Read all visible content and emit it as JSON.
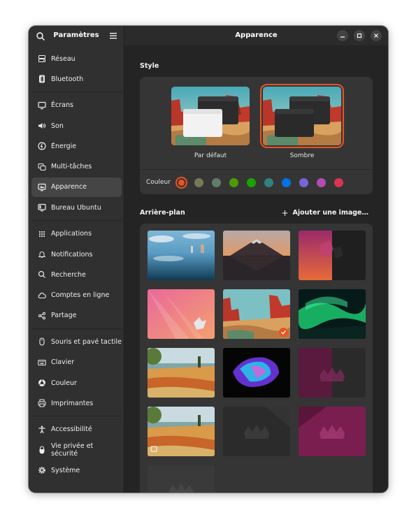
{
  "sidebar": {
    "title": "Paramètres",
    "items": [
      {
        "label": "Réseau",
        "icon": "network-icon"
      },
      {
        "label": "Bluetooth",
        "icon": "bluetooth-icon"
      },
      {
        "label": "Écrans",
        "icon": "display-icon"
      },
      {
        "label": "Son",
        "icon": "speaker-icon"
      },
      {
        "label": "Énergie",
        "icon": "power-icon"
      },
      {
        "label": "Multi-tâches",
        "icon": "multitasking-icon"
      },
      {
        "label": "Apparence",
        "icon": "appearance-icon",
        "active": true
      },
      {
        "label": "Bureau Ubuntu",
        "icon": "ubuntu-desktop-icon"
      },
      {
        "label": "Applications",
        "icon": "apps-grid-icon"
      },
      {
        "label": "Notifications",
        "icon": "bell-icon"
      },
      {
        "label": "Recherche",
        "icon": "search-icon"
      },
      {
        "label": "Comptes en ligne",
        "icon": "cloud-icon"
      },
      {
        "label": "Partage",
        "icon": "share-icon"
      },
      {
        "label": "Souris et pavé tactile",
        "icon": "mouse-icon"
      },
      {
        "label": "Clavier",
        "icon": "keyboard-icon"
      },
      {
        "label": "Couleur",
        "icon": "color-icon"
      },
      {
        "label": "Imprimantes",
        "icon": "printer-icon"
      },
      {
        "label": "Accessibilité",
        "icon": "accessibility-icon"
      },
      {
        "label": "Vie privée et sécurité",
        "icon": "privacy-icon"
      },
      {
        "label": "Système",
        "icon": "gear-icon"
      }
    ]
  },
  "main": {
    "title": "Apparence",
    "style": {
      "heading": "Style",
      "themes": [
        {
          "label": "Par défaut",
          "selected": false
        },
        {
          "label": "Sombre",
          "selected": true
        }
      ],
      "color_label": "Couleur",
      "accent_colors": [
        "#e95420",
        "#787859",
        "#657b69",
        "#4e9a06",
        "#18a303",
        "#308280",
        "#0073e5",
        "#7764d8",
        "#b34cb3",
        "#da3450"
      ],
      "accent_selected": 0
    },
    "background": {
      "heading": "Arrière-plan",
      "add_label": "Ajouter une image…",
      "selected_index": 4
    }
  },
  "colors": {
    "accent": "#e95420",
    "window_bg": "#242424",
    "sidebar_bg": "#303030",
    "card_bg": "#353535"
  }
}
